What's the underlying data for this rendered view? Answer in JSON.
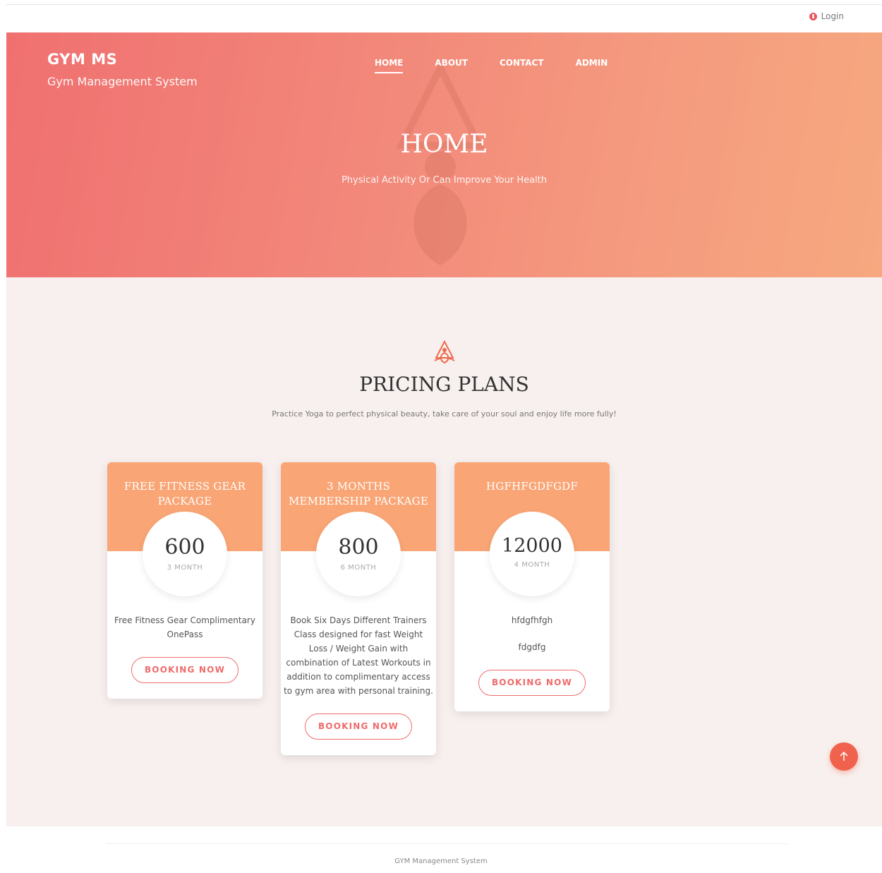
{
  "topbar": {
    "login_label": "Login",
    "login_icon": "user-icon"
  },
  "brand": {
    "name": "GYM MS",
    "subtitle": "Gym Management System"
  },
  "nav": {
    "items": [
      "HOME",
      "ABOUT",
      "CONTACT",
      "ADMIN"
    ],
    "active": "HOME"
  },
  "hero": {
    "title": "HOME",
    "tagline": "Physical Activity Or Can Improve Your Health"
  },
  "pricing": {
    "title": "PRICING PLANS",
    "subtitle": "Practice Yoga to perfect physical beauty, take care of your soul and enjoy life more fully!",
    "icon": "yoga-lotus-icon",
    "plans": [
      {
        "name": "FREE FITNESS GEAR PACKAGE",
        "price": "600",
        "period": "3 MONTH",
        "description": [
          "Free Fitness Gear Complimentary OnePass"
        ],
        "button": "BOOKING NOW"
      },
      {
        "name": "3 MONTHS MEMBERSHIP PACKAGE",
        "price": "800",
        "period": "6 MONTH",
        "description": [
          "Book Six Days Different Trainers Class designed for fast Weight Loss / Weight Gain with combination of Latest Workouts in addition to complimentary access to gym area with personal training."
        ],
        "button": "BOOKING NOW"
      },
      {
        "name": "HGFHFGDFGDF",
        "price": "12000",
        "period": "4 MONTH",
        "description": [
          "hfdgfhfgh",
          "fdgdfg"
        ],
        "button": "BOOKING NOW"
      }
    ]
  },
  "back_to_top": {
    "icon": "arrow-up-icon"
  },
  "footer": {
    "text": "GYM Management System"
  },
  "colors": {
    "accent": "#ef6b6b",
    "card_header": "#f9a575",
    "hero_start": "#f07070",
    "hero_end": "#f6a87f",
    "section_bg": "#f8f0ee"
  }
}
